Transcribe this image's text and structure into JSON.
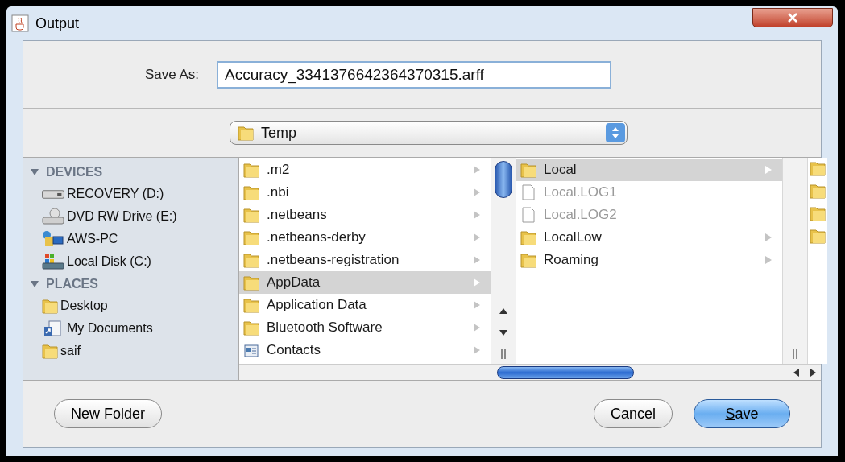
{
  "window": {
    "title": "Output"
  },
  "save_as": {
    "label": "Save As:",
    "value": "Accuracy_3341376642364370315.arff"
  },
  "location": {
    "value": "Temp"
  },
  "sidebar": {
    "sections": [
      {
        "title": "DEVICES",
        "expanded": true,
        "items": [
          {
            "label": "RECOVERY (D:)",
            "kind": "drive"
          },
          {
            "label": "DVD RW Drive (E:)",
            "kind": "dvd"
          },
          {
            "label": "AWS-PC",
            "kind": "network"
          },
          {
            "label": "Local Disk (C:)",
            "kind": "disk"
          }
        ]
      },
      {
        "title": "PLACES",
        "expanded": true,
        "items": [
          {
            "label": "Desktop",
            "kind": "folder"
          },
          {
            "label": "My Documents",
            "kind": "documents"
          },
          {
            "label": "saif",
            "kind": "folder"
          }
        ]
      }
    ]
  },
  "columns": [
    {
      "items": [
        {
          "name": ".m2",
          "kind": "folder",
          "selected": false
        },
        {
          "name": ".nbi",
          "kind": "folder",
          "selected": false
        },
        {
          "name": ".netbeans",
          "kind": "folder",
          "selected": false
        },
        {
          "name": ".netbeans-derby",
          "kind": "folder",
          "selected": false
        },
        {
          "name": ".netbeans-registration",
          "kind": "folder",
          "selected": false
        },
        {
          "name": "AppData",
          "kind": "folder",
          "selected": true
        },
        {
          "name": "Application Data",
          "kind": "folder",
          "selected": false
        },
        {
          "name": "Bluetooth Software",
          "kind": "folder",
          "selected": false
        },
        {
          "name": "Contacts",
          "kind": "contacts",
          "selected": false
        }
      ]
    },
    {
      "items": [
        {
          "name": "Local",
          "kind": "folder",
          "selected": true
        },
        {
          "name": "Local.LOG1",
          "kind": "file",
          "selected": false
        },
        {
          "name": "Local.LOG2",
          "kind": "file",
          "selected": false
        },
        {
          "name": "LocalLow",
          "kind": "folder",
          "selected": false
        },
        {
          "name": "Roaming",
          "kind": "folder",
          "selected": false
        }
      ]
    }
  ],
  "left_buttons": [
    {
      "label": "New Folder",
      "kind": "plain"
    }
  ],
  "right_buttons": [
    {
      "label": "Cancel",
      "kind": "plain"
    },
    {
      "label": "Save",
      "kind": "default",
      "mnemonic_underlined": true
    }
  ]
}
